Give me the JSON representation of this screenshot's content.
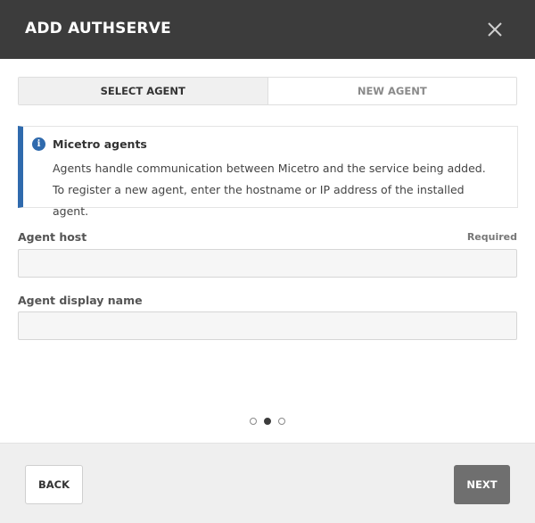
{
  "dialog": {
    "title": "ADD AUTHSERVE",
    "close_icon": "close-icon"
  },
  "tabs": [
    {
      "label": "SELECT AGENT",
      "active": true
    },
    {
      "label": "NEW AGENT",
      "active": false
    }
  ],
  "info": {
    "icon": "info-icon",
    "icon_glyph": "i",
    "title": "Micetro agents",
    "text": "Agents handle communication between Micetro and the service being added. To register a new agent, enter the hostname or IP address of the installed agent."
  },
  "fields": {
    "agent_host": {
      "label": "Agent host",
      "required_text": "Required",
      "value": ""
    },
    "agent_display_name": {
      "label": "Agent display name",
      "value": ""
    }
  },
  "pager": {
    "total": 3,
    "current": 2
  },
  "footer": {
    "back_label": "BACK",
    "next_label": "NEXT"
  },
  "colors": {
    "header_bg": "#3c3c3c",
    "accent": "#2f6aad",
    "next_button_bg": "#6f6f6f",
    "footer_bg": "#efefef"
  }
}
